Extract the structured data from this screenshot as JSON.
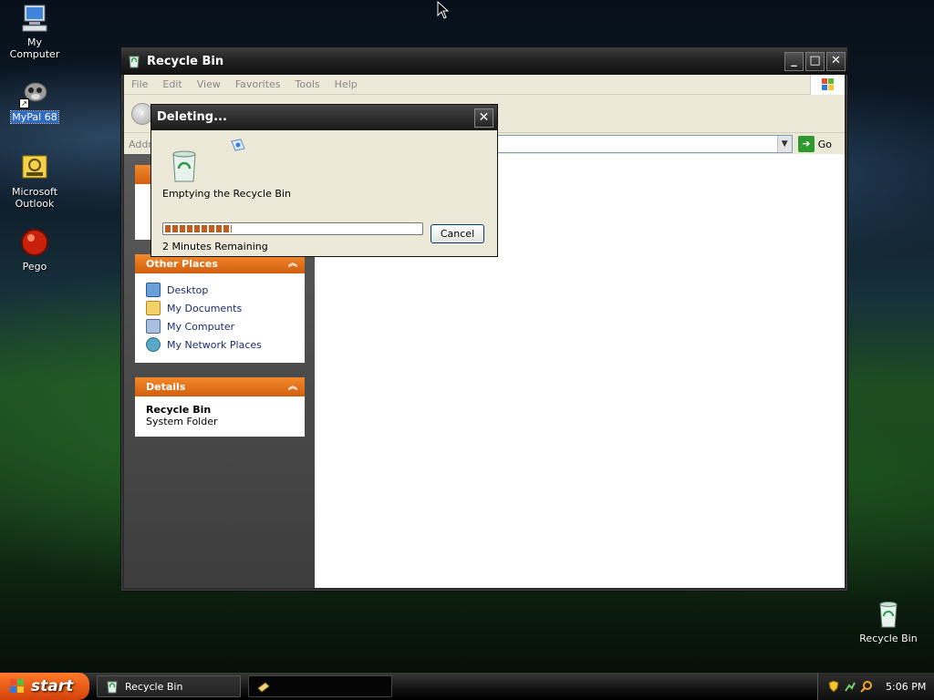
{
  "desktop": {
    "icons": [
      {
        "label": "My Computer"
      },
      {
        "label": "MyPal 68"
      },
      {
        "label": "Microsoft Outlook"
      },
      {
        "label": "Pego"
      },
      {
        "label": "Recycle Bin"
      }
    ]
  },
  "window": {
    "title": "Recycle Bin",
    "controls": {
      "minimize": "_",
      "maximize": "□",
      "close": "✕"
    },
    "menu": [
      "File",
      "Edit",
      "View",
      "Favorites",
      "Tools",
      "Help"
    ],
    "address_label": "Addr",
    "go_label": "Go",
    "other_places": {
      "header": "Other Places",
      "items": [
        "Desktop",
        "My Documents",
        "My Computer",
        "My Network Places"
      ]
    },
    "details": {
      "header": "Details",
      "name": "Recycle Bin",
      "type": "System Folder"
    }
  },
  "dialog": {
    "title": "Deleting...",
    "message": "Emptying the Recycle Bin",
    "progress_fraction": 0.26,
    "remaining": "2 Minutes Remaining",
    "cancel_label": "Cancel"
  },
  "taskbar": {
    "start_label": "start",
    "tasks": [
      {
        "label": "Recycle Bin"
      },
      {
        "label": ""
      }
    ],
    "clock": "5:06 PM"
  }
}
